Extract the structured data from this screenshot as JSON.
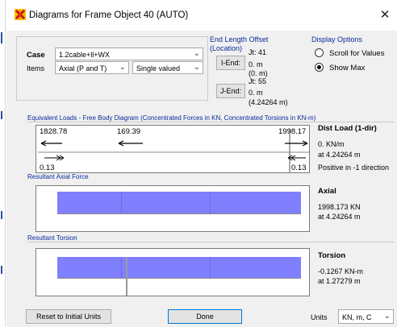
{
  "window": {
    "title": "Diagrams for Frame Object 40  (AUTO)",
    "close_symbol": "✕"
  },
  "case_panel": {
    "case_label": "Case",
    "case_value": "1.2cable+ll+WX",
    "items_label": "Items",
    "items_value": "Axial (P and T)",
    "mode_value": "Single valued"
  },
  "end_length_offset": {
    "title": "End Length Offset",
    "subtitle": "(Location)",
    "iend_button": "I-End:",
    "jend_button": "J-End:",
    "i_joint": "Jt:  41",
    "i_offset": "0. m",
    "i_location": "(0. m)",
    "j_joint": "Jt:  55",
    "j_offset": "0. m",
    "j_location": "(4.24264 m)"
  },
  "display_options": {
    "title": "Display Options",
    "options": [
      {
        "label": "Scroll for Values",
        "selected": false
      },
      {
        "label": "Show Max",
        "selected": true
      }
    ]
  },
  "equivalent_loads": {
    "title": "Equivalent Loads - Free Body Diagram  (Concentrated Forces in KN, Concentrated Torsions in KN-m)",
    "left_force": "1828.78",
    "mid_force": "169.39",
    "right_force": "1998.17",
    "left_torsion": "0.13",
    "right_torsion": "0.13",
    "info_title": "Dist Load (1-dir)",
    "info_value": "0. KN/m",
    "info_location": "at 4.24264 m",
    "info_note": "Positive in -1 direction"
  },
  "axial": {
    "title": "Resultant Axial Force",
    "info_title": "Axial",
    "info_value": "1998.173 KN",
    "info_location": "at 4.24264 m"
  },
  "torsion": {
    "title": "Resultant Torsion",
    "info_title": "Torsion",
    "info_value": "-0.1267 KN-m",
    "info_location": "at 1.27279 m"
  },
  "footer": {
    "reset_button": "Reset to Initial Units",
    "done_button": "Done",
    "units_label": "Units",
    "units_value": "KN, m, C"
  },
  "colors": {
    "diagram_fill": "#8080ff",
    "header_blue": "#0a2a9c",
    "window_bg": "#f0f0f0"
  }
}
